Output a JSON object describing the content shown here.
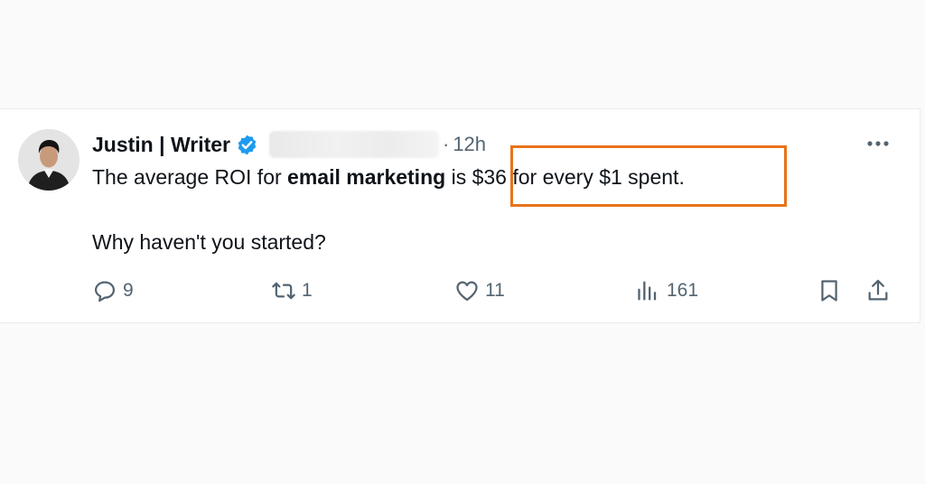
{
  "tweet": {
    "author_name": "Justin | Writer",
    "separator": "·",
    "time": "12h",
    "text_before": "The average ROI for ",
    "text_bold": "email marketing",
    "text_is": " is ",
    "text_highlight": "$36 for every $1 spent.",
    "line2": "Why haven't you started?",
    "highlight_color": "#e8731a",
    "verified_color": "#1d9bf0",
    "icons": {
      "more": "more-dots-icon",
      "verified": "verified-badge-icon"
    }
  },
  "actions": {
    "reply": {
      "icon": "reply-icon",
      "count": "9"
    },
    "retweet": {
      "icon": "retweet-icon",
      "count": "1"
    },
    "like": {
      "icon": "heart-icon",
      "count": "11"
    },
    "views": {
      "icon": "views-icon",
      "count": "161"
    },
    "bookmark": {
      "icon": "bookmark-icon"
    },
    "share": {
      "icon": "share-icon"
    }
  }
}
